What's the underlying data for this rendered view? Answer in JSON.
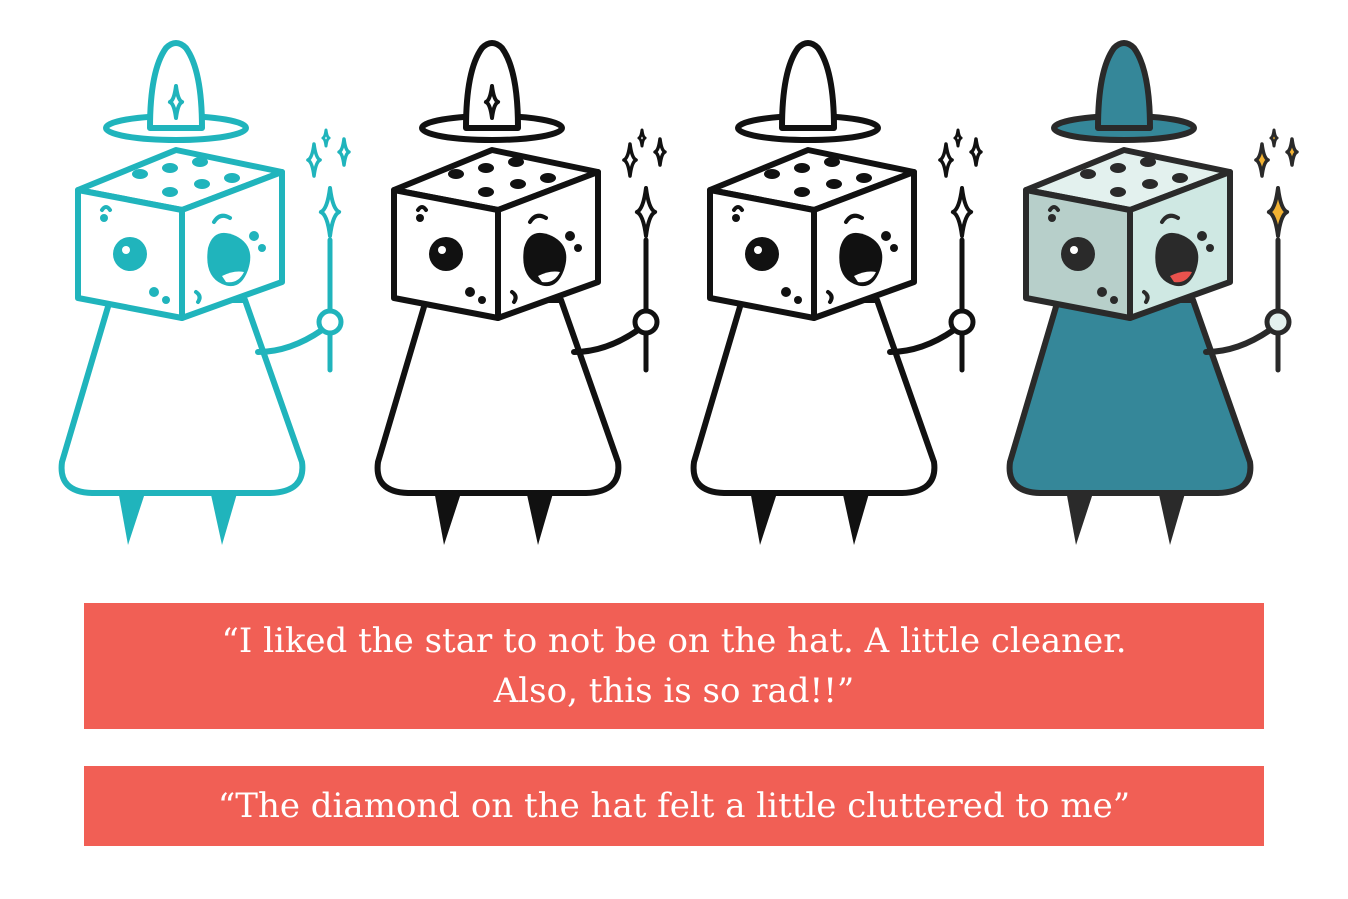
{
  "colors": {
    "sketch_line": "#20b4bc",
    "ink": "#111111",
    "robe_fill": "#358799",
    "hat_fill": "#358799",
    "die_top": "#e3f1ee",
    "die_front": "#b7cfca",
    "die_side": "#cfe8e3",
    "sparkle": "#f2b233",
    "mouth": "#e9524d",
    "quote_bg": "#f15f55",
    "quote_text": "#ffffff"
  },
  "figures": [
    {
      "name": "sketch",
      "style": "sketch",
      "hat_gem": true
    },
    {
      "name": "lineart-gem",
      "style": "line",
      "hat_gem": true
    },
    {
      "name": "lineart-plain",
      "style": "line",
      "hat_gem": false
    },
    {
      "name": "colored",
      "style": "color",
      "hat_gem": false
    }
  ],
  "quotes": [
    {
      "lines": [
        "“I liked the star to not be on the hat. A little cleaner.",
        "Also, this is so rad!!”"
      ]
    },
    {
      "lines": [
        "“The diamond on the hat felt a little cluttered to me”"
      ]
    }
  ]
}
